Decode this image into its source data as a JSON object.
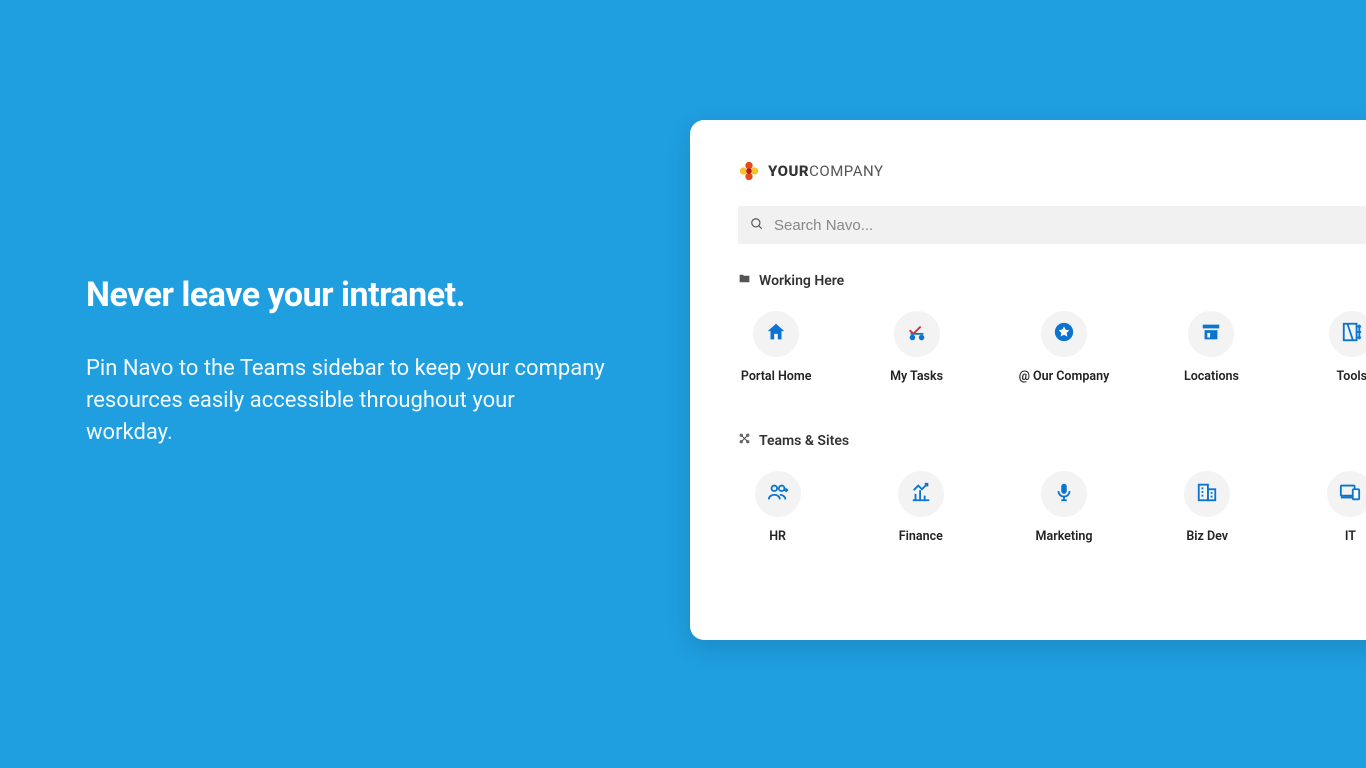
{
  "hero": {
    "title": "Never leave your intranet.",
    "body": "Pin Navo to the Teams sidebar to keep your company resources easily accessible throughout your workday."
  },
  "brand": {
    "bold": "YOUR",
    "rest": "COMPANY"
  },
  "search": {
    "placeholder": "Search Navo..."
  },
  "sections": {
    "working_here": {
      "label": "Working Here",
      "tiles": [
        {
          "label": "Portal Home",
          "icon": "home-icon"
        },
        {
          "label": "My Tasks",
          "icon": "tasks-icon"
        },
        {
          "label": "@ Our Company",
          "icon": "star-badge-icon"
        },
        {
          "label": "Locations",
          "icon": "store-icon"
        },
        {
          "label": "Tools",
          "icon": "tools-icon"
        }
      ]
    },
    "teams_sites": {
      "label": "Teams & Sites",
      "tiles": [
        {
          "label": "HR",
          "icon": "people-icon"
        },
        {
          "label": "Finance",
          "icon": "chart-icon"
        },
        {
          "label": "Marketing",
          "icon": "mic-icon"
        },
        {
          "label": "Biz Dev",
          "icon": "building-icon"
        },
        {
          "label": "IT",
          "icon": "devices-icon"
        }
      ]
    }
  },
  "colors": {
    "accent": "#1f9ee0",
    "icon_blue": "#0b74d1"
  }
}
